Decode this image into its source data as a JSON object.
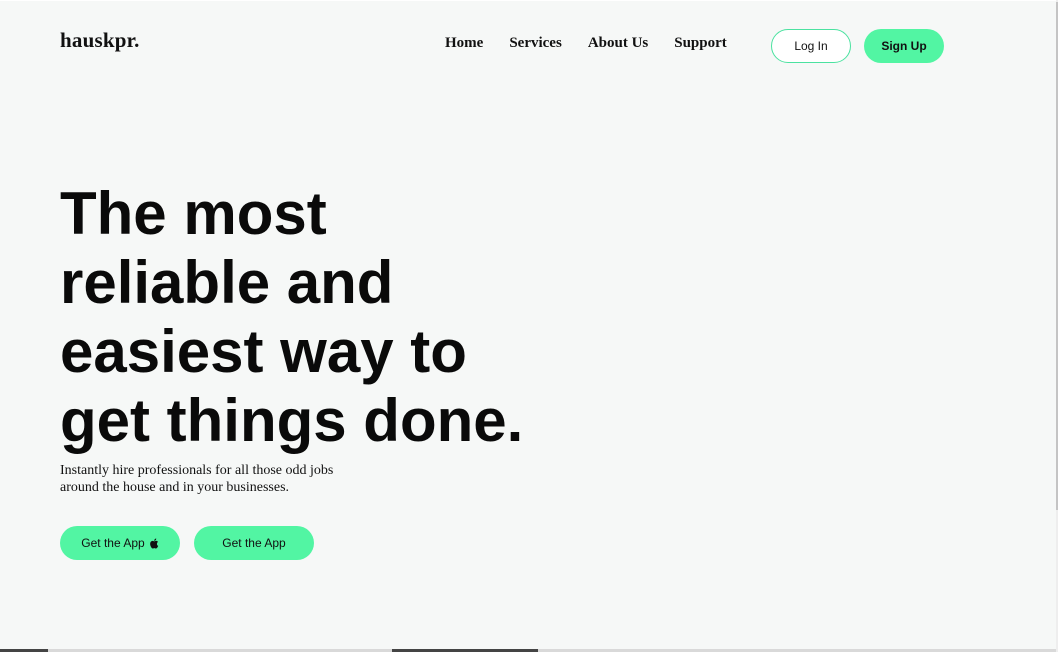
{
  "brand": {
    "logo_text": "hauskpr."
  },
  "nav": {
    "items": [
      {
        "label": "Home"
      },
      {
        "label": "Services"
      },
      {
        "label": "About Us"
      },
      {
        "label": "Support"
      }
    ]
  },
  "auth": {
    "login_label": "Log In",
    "signup_label": "Sign Up"
  },
  "hero": {
    "title_line_1": "The most",
    "title_line_2": "reliable and",
    "title_line_3": "easiest way to",
    "title_line_4": "get things done.",
    "subtitle_line_1": "Instantly hire professionals for all those odd jobs",
    "subtitle_line_2": "around the house and in your businesses."
  },
  "cta": {
    "ios_label": "Get the App",
    "ios_icon": "apple-icon",
    "android_label": "Get the App"
  },
  "colors": {
    "accent": "#52f5a3",
    "accent_border": "#4be2a0",
    "background": "#f6f8f7",
    "text": "#111111"
  }
}
